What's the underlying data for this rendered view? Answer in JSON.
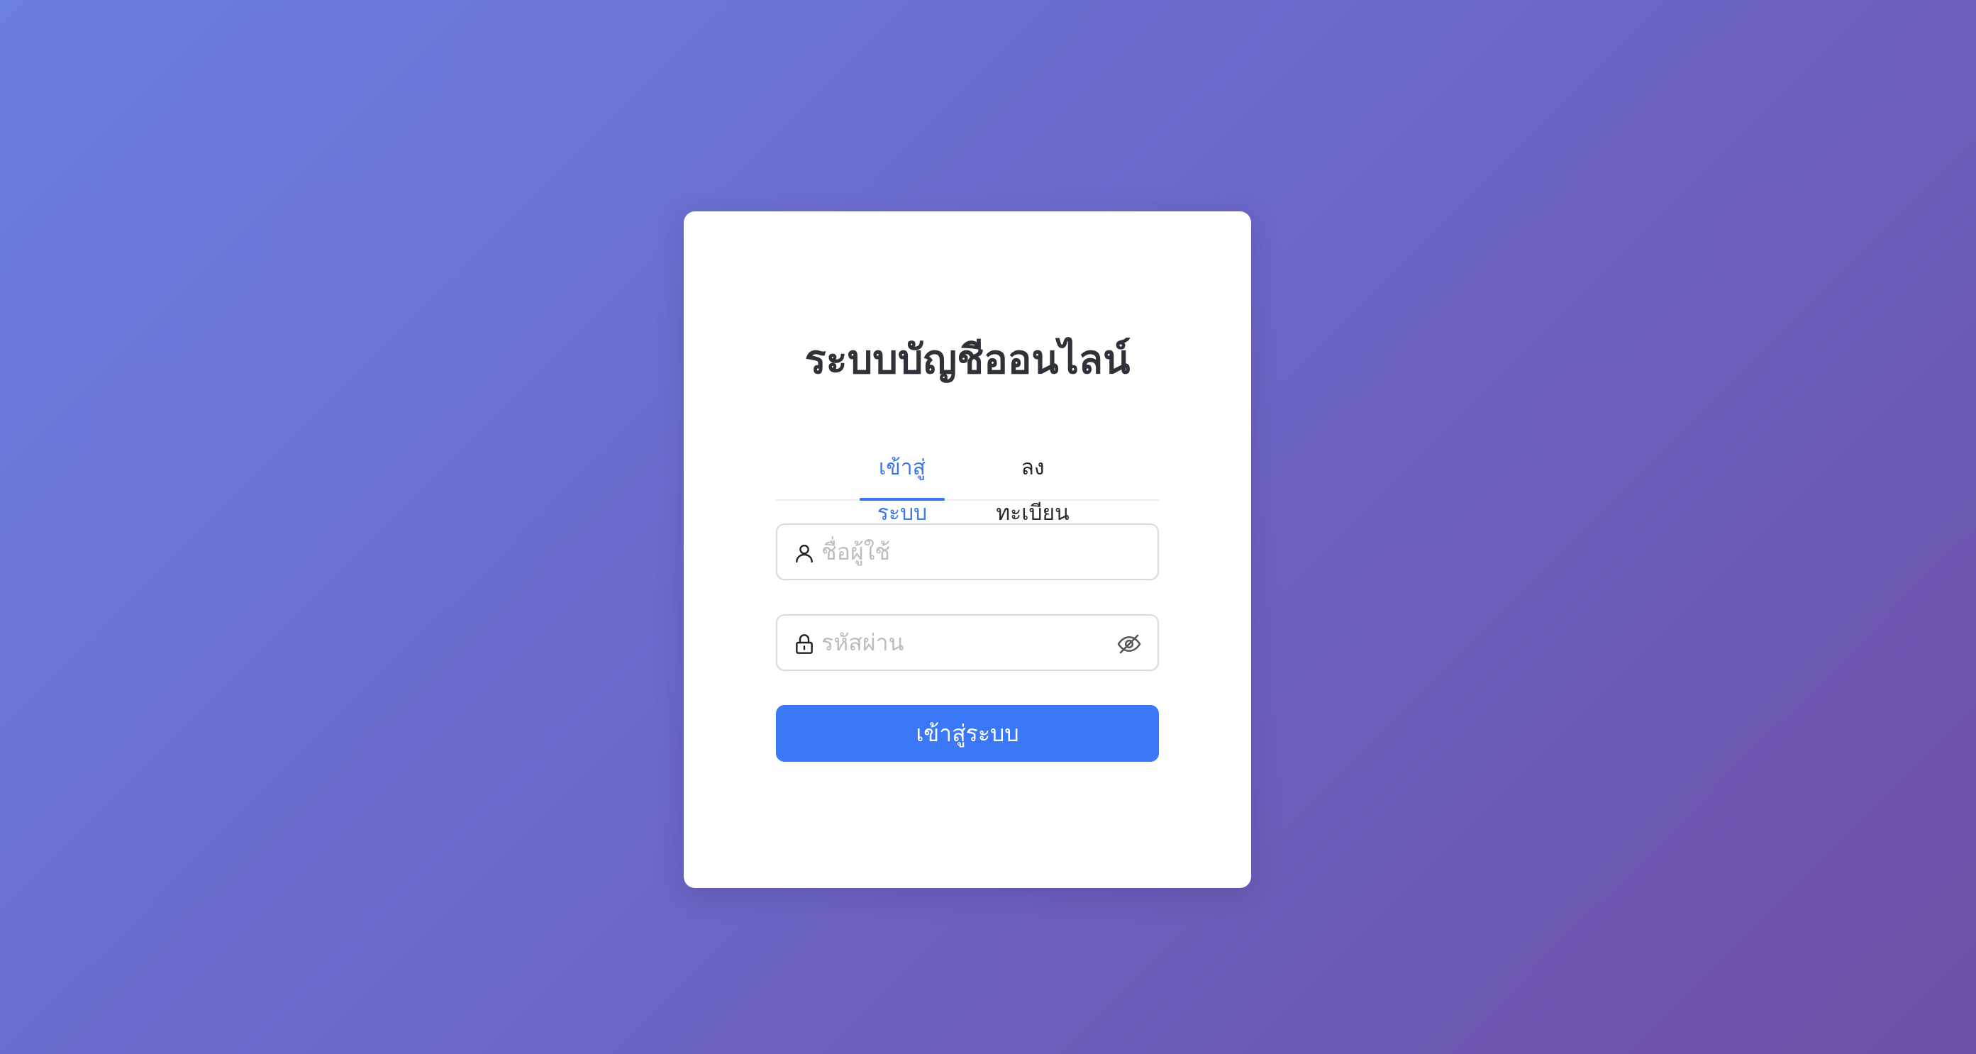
{
  "app": {
    "title": "ระบบบัญชีออนไลน์"
  },
  "tabs": [
    {
      "label": "เข้าสู่ระบบ",
      "active": true
    },
    {
      "label": "ลงทะเบียน",
      "active": false
    }
  ],
  "form": {
    "username": {
      "placeholder": "ชื่อผู้ใช้",
      "value": "",
      "icon": "user-icon"
    },
    "password": {
      "placeholder": "รหัสผ่าน",
      "value": "",
      "icon": "lock-icon",
      "toggle_icon": "eye-off-icon"
    },
    "submit_label": "เข้าสู่ระบบ"
  },
  "colors": {
    "accent": "#3b78f5",
    "background_start": "#6b7fe0",
    "background_end": "#6e4fa6",
    "title_text": "#2f3238",
    "placeholder": "#bdbdc2"
  }
}
